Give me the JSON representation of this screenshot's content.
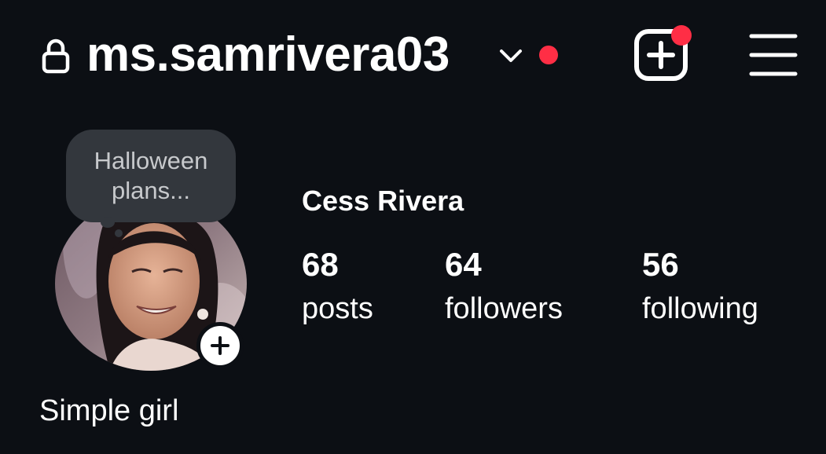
{
  "header": {
    "username": "ms.samrivera03",
    "lock_icon": "lock-icon",
    "switch_account_icon": "chevron-down-icon",
    "create_icon": "plus-square-icon",
    "menu_icon": "hamburger-menu-icon"
  },
  "note": {
    "text": "Halloween plans..."
  },
  "profile": {
    "display_name": "Cess Rivera",
    "bio": "Simple girl",
    "stats": [
      {
        "count": "68",
        "label": "posts"
      },
      {
        "count": "64",
        "label": "followers"
      },
      {
        "count": "56",
        "label": "following"
      }
    ]
  },
  "colors": {
    "background": "#0c0f14",
    "text": "#ffffff",
    "notification_red": "#ff2e45",
    "note_bubble": "#33373d",
    "note_text": "#c7c9cc"
  }
}
